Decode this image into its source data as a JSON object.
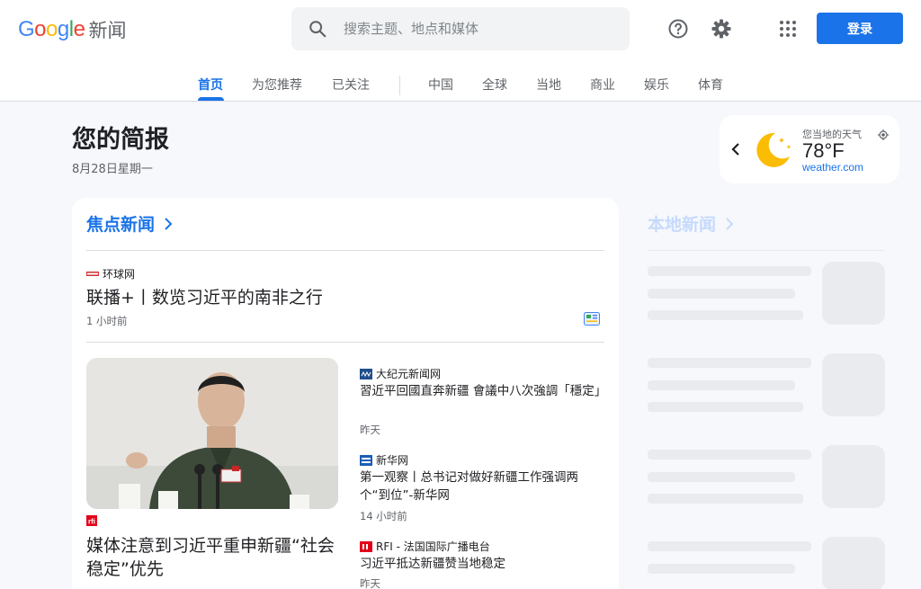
{
  "header": {
    "logo_text": "Google",
    "logo_product": "新闻",
    "search_placeholder": "搜索主题、地点和媒体",
    "login_label": "登录"
  },
  "nav": {
    "tabs": [
      "首页",
      "为您推荐",
      "已关注",
      "中国",
      "全球",
      "当地",
      "商业",
      "娱乐",
      "体育"
    ],
    "active": "首页"
  },
  "briefing": {
    "title": "您的简报",
    "date": "8月28日星期一"
  },
  "weather": {
    "label": "您当地的天气",
    "temp": "78°F",
    "link": "weather.com",
    "icon": "moon-night-icon"
  },
  "top_stories": {
    "heading": "焦点新闻",
    "lead": {
      "source": "环球网",
      "headline": "联播+丨数览习近平的南非之行",
      "time": "1 小时前"
    },
    "feature": {
      "source_logo": "rfi",
      "headline": "媒体注意到习近平重申新疆“社会稳定”优先"
    },
    "side": [
      {
        "source": "大纪元新闻网",
        "headline": "習近平回國直奔新疆 會議中八次強調「穩定」",
        "time": "昨天"
      },
      {
        "source": "新华网",
        "headline": "第一观察丨总书记对做好新疆工作强调两个“到位”-新华网",
        "time": "14 小时前"
      },
      {
        "source": "RFI - 法国国际广播电台",
        "headline": "习近平抵达新疆赞当地稳定",
        "time": "昨天"
      }
    ]
  },
  "local_news": {
    "heading": "本地新闻"
  },
  "colors": {
    "accent": "#1a73e8",
    "background": "#f6f8fc"
  }
}
